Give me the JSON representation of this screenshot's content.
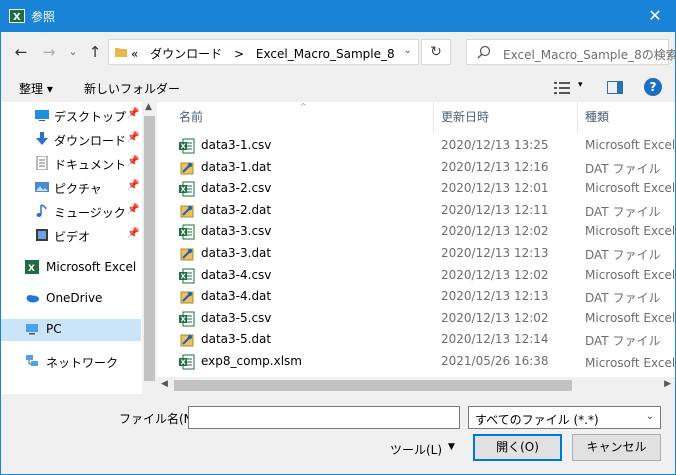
{
  "window": {
    "title": "参照",
    "close_glyph": "✕"
  },
  "nav": {
    "back": "←",
    "forward": "→",
    "dropdown": "⌄",
    "up": "↑"
  },
  "address": {
    "crumbs": [
      "«",
      "ダウンロード",
      ">",
      "Excel_Macro_Sample_8"
    ],
    "dropdown": "⌄",
    "refresh": "↻"
  },
  "search": {
    "placeholder": "Excel_Macro_Sample_8の検索"
  },
  "toolbar": {
    "organize": "整理 ▾",
    "new_folder": "新しいフォルダー",
    "view_dropdown": "▾",
    "help": "?"
  },
  "sidebar": {
    "items": [
      {
        "label": "デスクトップ",
        "icon": "desktop-icon",
        "pinned": true
      },
      {
        "label": "ダウンロード",
        "icon": "download-icon",
        "pinned": true
      },
      {
        "label": "ドキュメント",
        "icon": "documents-icon",
        "pinned": true
      },
      {
        "label": "ピクチャ",
        "icon": "pictures-icon",
        "pinned": true
      },
      {
        "label": "ミュージック",
        "icon": "music-icon",
        "pinned": true
      },
      {
        "label": "ビデオ",
        "icon": "video-icon",
        "pinned": true
      },
      {
        "label": "Microsoft Excel",
        "icon": "excel-icon",
        "pinned": false
      },
      {
        "label": "OneDrive",
        "icon": "onedrive-icon",
        "pinned": false
      },
      {
        "label": "PC",
        "icon": "pc-icon",
        "pinned": false,
        "selected": true
      },
      {
        "label": "ネットワーク",
        "icon": "network-icon",
        "pinned": false
      }
    ],
    "pin_glyph": "📌",
    "scroll_up": "▲"
  },
  "filelist": {
    "columns": {
      "name": "名前",
      "modified": "更新日時",
      "type": "種類"
    },
    "sort_indicator": "^",
    "files": [
      {
        "name": "data3-1.csv",
        "modified": "2020/12/13 13:25",
        "type": "Microsoft Excel C",
        "kind": "csv"
      },
      {
        "name": "data3-1.dat",
        "modified": "2020/12/13 12:16",
        "type": "DAT ファイル",
        "kind": "dat"
      },
      {
        "name": "data3-2.csv",
        "modified": "2020/12/13 12:01",
        "type": "Microsoft Excel C",
        "kind": "csv"
      },
      {
        "name": "data3-2.dat",
        "modified": "2020/12/13 12:11",
        "type": "DAT ファイル",
        "kind": "dat"
      },
      {
        "name": "data3-3.csv",
        "modified": "2020/12/13 12:02",
        "type": "Microsoft Excel C",
        "kind": "csv"
      },
      {
        "name": "data3-3.dat",
        "modified": "2020/12/13 12:13",
        "type": "DAT ファイル",
        "kind": "dat"
      },
      {
        "name": "data3-4.csv",
        "modified": "2020/12/13 12:02",
        "type": "Microsoft Excel C",
        "kind": "csv"
      },
      {
        "name": "data3-4.dat",
        "modified": "2020/12/13 12:13",
        "type": "DAT ファイル",
        "kind": "dat"
      },
      {
        "name": "data3-5.csv",
        "modified": "2020/12/13 12:02",
        "type": "Microsoft Excel C",
        "kind": "csv"
      },
      {
        "name": "data3-5.dat",
        "modified": "2020/12/13 12:14",
        "type": "DAT ファイル",
        "kind": "dat"
      },
      {
        "name": "exp8_comp.xlsm",
        "modified": "2021/05/26 16:38",
        "type": "Microsoft Excel マ",
        "kind": "xlsm"
      }
    ],
    "scroll_left": "◀",
    "scroll_right": "▶"
  },
  "bottom": {
    "filename_label": "ファイル名(N):",
    "filename_value": "",
    "filetype_value": "すべてのファイル (*.*)",
    "filetype_dropdown": "⌄",
    "tools_label": "ツール(L)",
    "tools_dropdown": "▼",
    "open_label": "開く(O)",
    "cancel_label": "キャンセル"
  },
  "colors": {
    "titlebar": "#1883d7",
    "selection": "#cce4f7",
    "excel_green": "#1d6f42",
    "accent": "#0078d7"
  }
}
